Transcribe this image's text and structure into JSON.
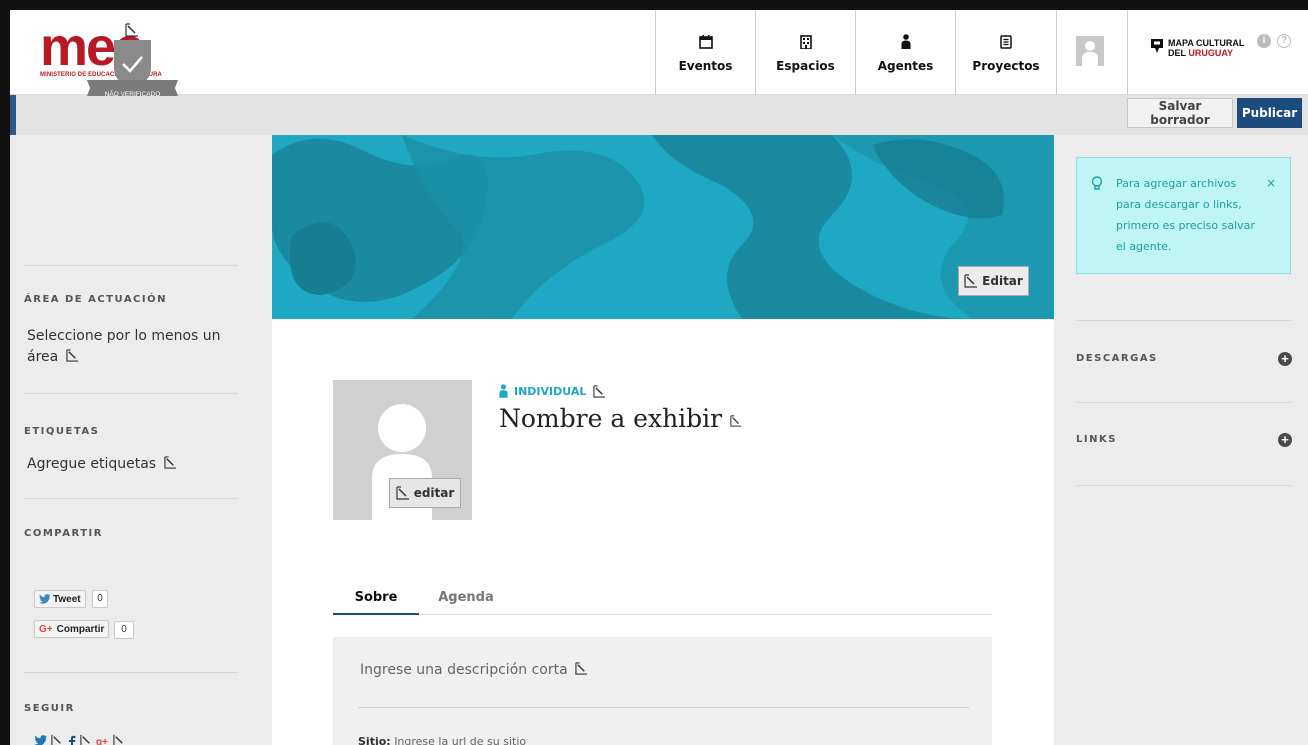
{
  "header": {
    "logo_main": "mec",
    "logo_sub": "MINISTERIO DE EDUCACIÓN Y CULTURA",
    "nav": [
      {
        "label": "Eventos",
        "icon": "calendar-icon"
      },
      {
        "label": "Espacios",
        "icon": "building-icon"
      },
      {
        "label": "Agentes",
        "icon": "person-icon"
      },
      {
        "label": "Proyectos",
        "icon": "document-icon"
      }
    ],
    "mapa_line1": "MAPA CULTURAL",
    "mapa_line2_prefix": "DEL ",
    "mapa_line2_red": "URUGUAY",
    "info_icon": "i",
    "help_icon": "?"
  },
  "toolbar": {
    "save_draft": "Salvar borrador",
    "publish": "Publicar"
  },
  "left": {
    "badge_text": "NÃO VERIFICADO",
    "area_title": "ÁREA DE ACTUACIÓN",
    "area_text_1": "Seleccione por lo menos un",
    "area_text_2": "área",
    "tags_title": "ETIQUETAS",
    "tags_text": "Agregue etiquetas",
    "share_title": "COMPARTIR",
    "tweet_label": "Tweet",
    "tweet_count": "0",
    "gplus_label": "Compartir",
    "gplus_prefix": "G+",
    "gplus_count": "0",
    "follow_title": "SEGUIR"
  },
  "cover": {
    "edit_label": "Editar"
  },
  "profile": {
    "avatar_edit": "editar",
    "type": "INDIVIDUAL",
    "name": "Nombre a exhibir"
  },
  "tabs": [
    {
      "label": "Sobre",
      "active": true
    },
    {
      "label": "Agenda",
      "active": false
    }
  ],
  "about": {
    "short_desc": "Ingrese una descripción corta",
    "site_label": "Sitio:",
    "site_placeholder": "Ingrese la url de su sitio"
  },
  "right": {
    "alert_text": "Para agregar archivos para descargar o links, primero es preciso salvar el agente.",
    "alert_close": "×",
    "downloads_title": "DESCARGAS",
    "links_title": "LINKS",
    "plus_label": "+"
  },
  "colors": {
    "brand_red": "#b71a24",
    "publish_blue": "#1d4b7d",
    "cover_cyan": "#1fa8c3",
    "alert_bg": "#bff5f5"
  }
}
